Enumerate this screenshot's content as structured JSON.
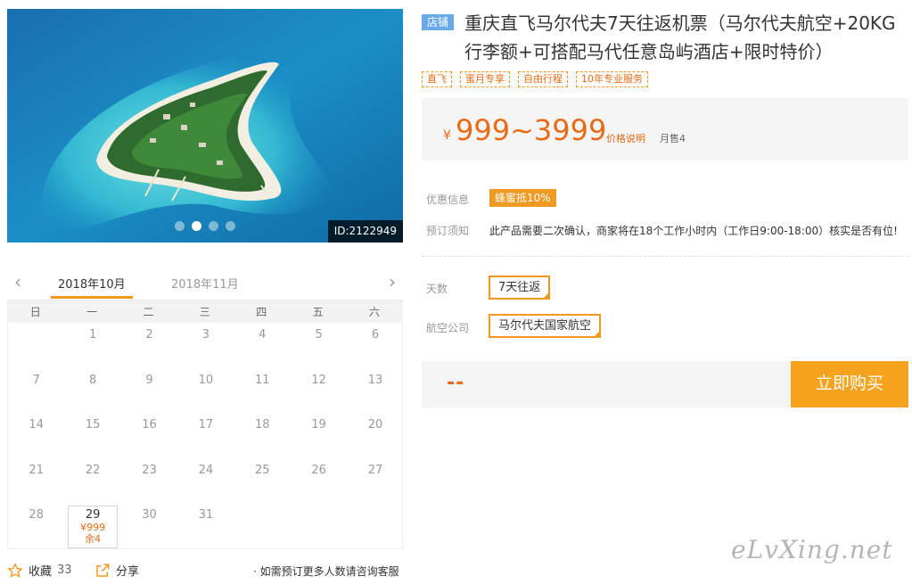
{
  "hero": {
    "id_label": "ID:2122949",
    "slide_count": 4,
    "active_slide": 2
  },
  "calendar": {
    "months": [
      "2018年10月",
      "2018年11月"
    ],
    "active_month": 0,
    "weekdays": [
      "日",
      "一",
      "二",
      "三",
      "四",
      "五",
      "六"
    ],
    "days": [
      [
        "",
        "1",
        "2",
        "3",
        "4",
        "5",
        "6"
      ],
      [
        "7",
        "8",
        "9",
        "10",
        "11",
        "12",
        "13"
      ],
      [
        "14",
        "15",
        "16",
        "17",
        "18",
        "19",
        "20"
      ],
      [
        "21",
        "22",
        "23",
        "24",
        "25",
        "26",
        "27"
      ],
      [
        "28",
        "29",
        "30",
        "31",
        "",
        "",
        ""
      ]
    ],
    "selected": {
      "day": "29",
      "price": "¥999",
      "stock": "余4"
    }
  },
  "footer": {
    "favorite_label": "收藏",
    "favorite_count": "33",
    "share_label": "分享",
    "consult_note": "· 如需预订更多人数请咨询客服"
  },
  "product": {
    "shop_tag": "店铺",
    "title": "重庆直飞马尔代夫7天往返机票（马尔代夫航空+20KG行李额+可搭配马代任意岛屿酒店+限时特价）",
    "chips": [
      "直飞",
      "蜜月专享",
      "自由行程",
      "10年专业服务"
    ],
    "price_yen": "¥",
    "price_range": "999~3999",
    "price_note": "价格说明",
    "monthly_sales": "月售4",
    "promo_label": "优惠信息",
    "promo_tag": "蜂蜜抵10%",
    "notice_label": "预订须知",
    "notice_text": "此产品需要二次确认，商家将在18个工作小时内（工作日9:00-18:00）核实是否有位!",
    "days_label": "天数",
    "days_option": "7天往返",
    "airline_label": "航空公司",
    "airline_option": "马尔代夫国家航空",
    "total_placeholder": "--",
    "buy_label": "立即购买"
  },
  "watermark": "eLvXing.net",
  "colors": {
    "accent": "#f19a21",
    "price": "#e86c18",
    "buy_button": "#f5a21d",
    "shop_tag": "#6aa9e8"
  }
}
